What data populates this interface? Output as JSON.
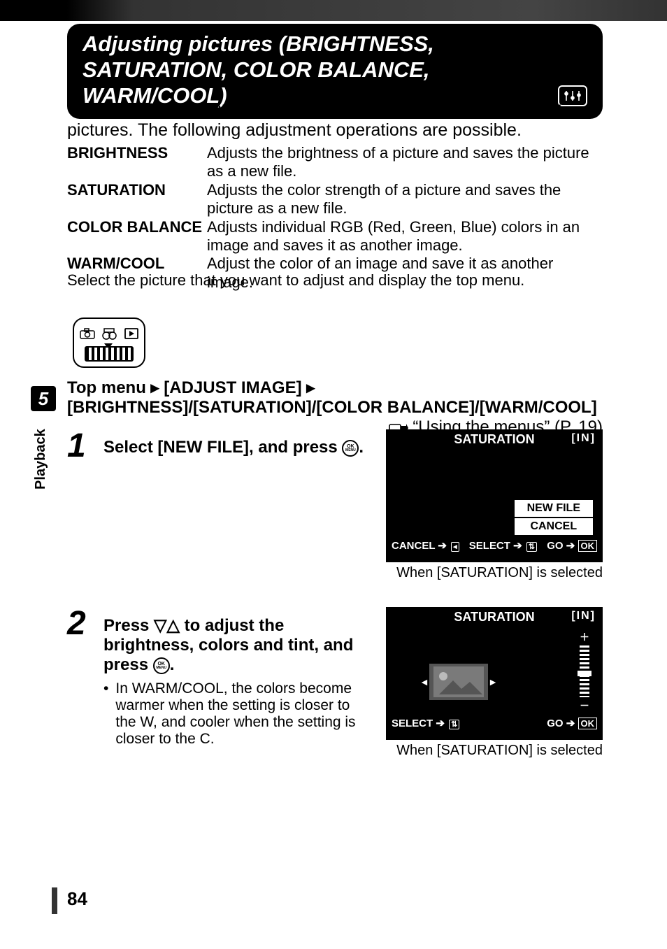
{
  "page_number": "84",
  "sidebar": {
    "chapter_num": "5",
    "chapter_label": "Playback"
  },
  "title": "Adjusting pictures (BRIGHTNESS, SATURATION, COLOR BALANCE, WARM/COOL)",
  "intro": "This function lets you adjust still pictures and store them as new pictures. The following adjustment operations are possible.",
  "definitions": [
    {
      "term": "BRIGHTNESS",
      "body": "Adjusts the brightness of a picture and saves the picture as a new file."
    },
    {
      "term": "SATURATION",
      "body": "Adjusts the color strength of a picture and saves the picture as a new file."
    },
    {
      "term": "COLOR BALANCE",
      "body": "Adjusts individual RGB (Red, Green, Blue) colors in an image and saves it as another image."
    },
    {
      "term": "WARM/COOL",
      "body": "Adjust the color of an image and save it as another image."
    }
  ],
  "select_note": "Select the picture that you want to adjust and display the top menu.",
  "breadcrumb": {
    "path": "Top menu ▸ [ADJUST IMAGE] ▸ [BRIGHTNESS]/[SATURATION]/[COLOR BALANCE]/[WARM/COOL]",
    "ref": "“Using the menus” (P. 19)"
  },
  "steps": {
    "s1": {
      "num": "1",
      "head_pre": "Select [NEW FILE], and press ",
      "head_post": ".",
      "screen": {
        "title": "SATURATION",
        "in": "[IN]",
        "options": [
          "NEW FILE",
          "CANCEL"
        ],
        "footer_left": "CANCEL",
        "footer_mid": "SELECT",
        "footer_right_label": "GO",
        "footer_right_ok": "OK"
      },
      "caption": "When [SATURATION] is selected"
    },
    "s2": {
      "num": "2",
      "head": "Press ▽△ to adjust the brightness, colors and tint, and press ",
      "head_post": ".",
      "bullet": "In WARM/COOL, the colors become warmer when the setting is closer to the W, and cooler when the setting is closer to the C.",
      "screen": {
        "title": "SATURATION",
        "in": "[IN]",
        "footer_left": "SELECT",
        "footer_right_label": "GO",
        "footer_right_ok": "OK"
      },
      "caption": "When [SATURATION] is selected"
    }
  },
  "ok_button": {
    "top": "OK",
    "bot": "MENU"
  },
  "glyphs": {
    "tri_down": "▽",
    "tri_up": "△",
    "small_right": "►",
    "small_left": "◄",
    "arrow": "➔"
  }
}
